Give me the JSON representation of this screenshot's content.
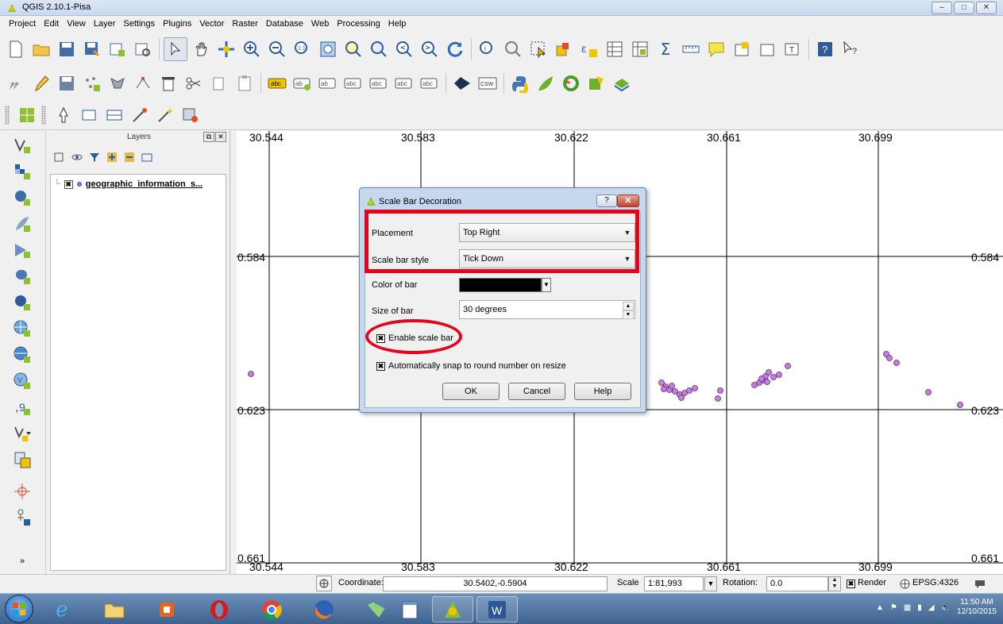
{
  "window": {
    "title": "QGIS 2.10.1-Pisa",
    "controls": [
      "–",
      "□",
      "✕"
    ]
  },
  "menu": [
    "Project",
    "Edit",
    "View",
    "Layer",
    "Settings",
    "Plugins",
    "Vector",
    "Raster",
    "Database",
    "Web",
    "Processing",
    "Help"
  ],
  "toolbar": {
    "csw_label": "CSW",
    "abc_label": "abc"
  },
  "layers_panel": {
    "title": "Layers",
    "layer": {
      "name": "geographic_information_s...",
      "checked": "✖"
    }
  },
  "map": {
    "x_ticks": [
      "30.544",
      "30.583",
      "30.622",
      "30.661",
      "30.699"
    ],
    "y_ticks": [
      "0.584",
      "0.623",
      "0.661"
    ],
    "point_color": "#c77ddc",
    "point_stroke": "#5a2a77"
  },
  "dialog": {
    "title": "Scale Bar Decoration",
    "help_btn": "?",
    "close_btn": "✕",
    "placement_label": "Placement",
    "placement_value": "Top Right",
    "style_label": "Scale bar style",
    "style_value": "Tick Down",
    "color_label": "Color of bar",
    "color_value": "#000000",
    "size_label": "Size of bar",
    "size_value": "30 degrees",
    "enable_label": "Enable scale bar",
    "enable_checked": "✖",
    "snap_label": "Automatically snap to round number on resize",
    "snap_checked": "✖",
    "ok": "OK",
    "cancel": "Cancel",
    "help": "Help",
    "highlight_color": "#e3051b"
  },
  "statusbar": {
    "coordinate_label": "Coordinate:",
    "coordinate_value": "30.5402,-0.5904",
    "scale_label": "Scale",
    "scale_value": "1:81,993",
    "rotation_label": "Rotation:",
    "rotation_value": "0.0",
    "render_label": "Render",
    "render_checked": "✖",
    "crs_label": "EPSG:4326"
  },
  "taskbar": {
    "time": "11:50 AM",
    "date": "12/10/2015"
  }
}
